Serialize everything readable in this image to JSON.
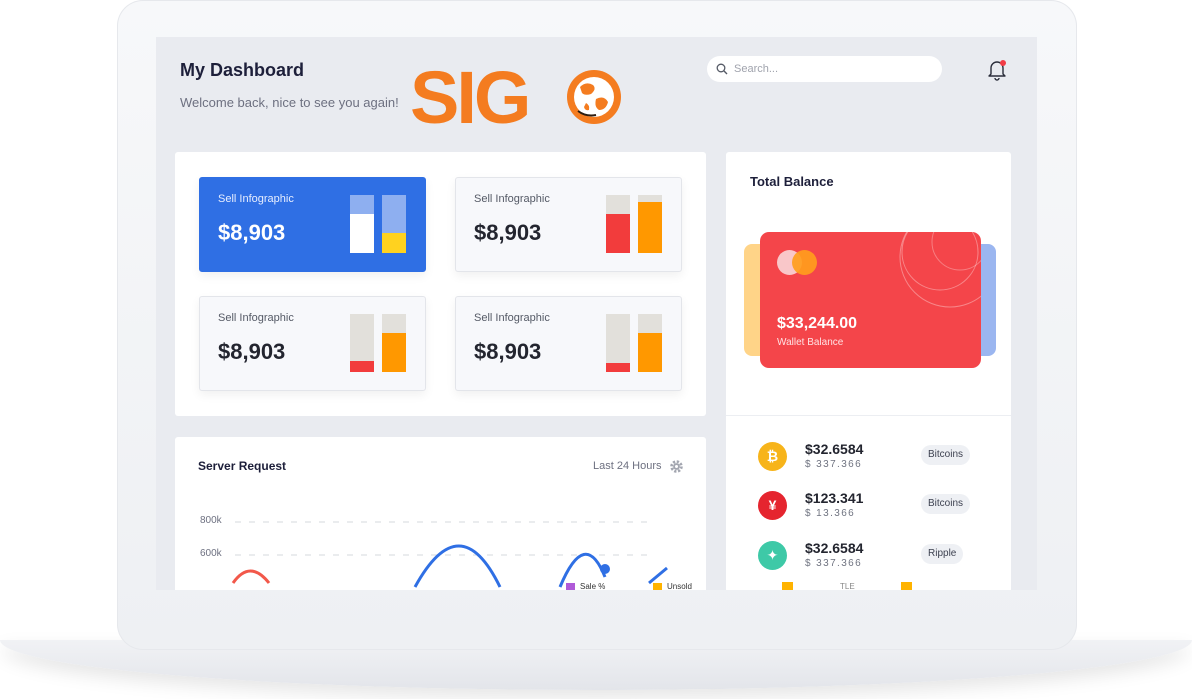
{
  "header": {
    "title": "My Dashboard",
    "subtitle": "Welcome back, nice to see you again!",
    "logo_text": "SIGO"
  },
  "search": {
    "placeholder": "Search..."
  },
  "stats": {
    "cards": [
      {
        "label": "Sell Infographic",
        "value": "$8,903",
        "active": true
      },
      {
        "label": "Sell Infographic",
        "value": "$8,903",
        "active": false
      },
      {
        "label": "Sell Infographic",
        "value": "$8,903",
        "active": false
      },
      {
        "label": "Sell Infographic",
        "value": "$8,903",
        "active": false
      }
    ]
  },
  "balance": {
    "title": "Total Balance",
    "wallet_amount": "$33,244.00",
    "wallet_caption": "Wallet Balance",
    "coins": [
      {
        "icon": "bitcoin-icon",
        "symbol": "₿",
        "value": "$32.6584",
        "sub": "$ 337.366",
        "tag": "Bitcoins",
        "color": "#f7b41a"
      },
      {
        "icon": "yen-icon",
        "symbol": "¥",
        "value": "$123.341",
        "sub": "$ 13.366",
        "tag": "Bitcoins",
        "color": "#e5252f"
      },
      {
        "icon": "ripple-icon",
        "symbol": "✦",
        "value": "$32.6584",
        "sub": "$ 337.366",
        "tag": "Ripple",
        "color": "#3ec9a7"
      }
    ]
  },
  "server": {
    "title": "Server Request",
    "range_label": "Last 24 Hours",
    "y_ticks": [
      "800k",
      "600k"
    ]
  },
  "legend": {
    "sale": "Sale %",
    "unsold": "Unsold",
    "tle": "TLE"
  },
  "colors": {
    "primary": "#2f6fe4",
    "red": "#f4454a",
    "orange": "#ff9800",
    "yellow": "#ffd21f",
    "logo_orange": "#f47c20"
  }
}
